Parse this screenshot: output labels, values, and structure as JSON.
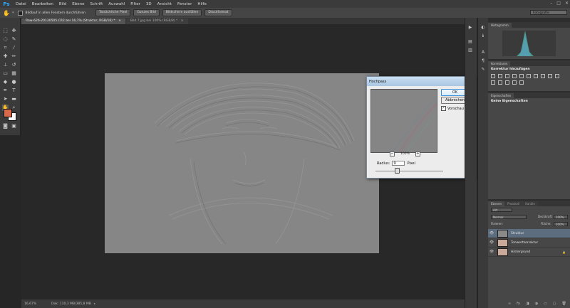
{
  "app": {
    "logo": "Ps"
  },
  "menu": [
    "Datei",
    "Bearbeiten",
    "Bild",
    "Ebene",
    "Schrift",
    "Auswahl",
    "Filter",
    "3D",
    "Ansicht",
    "Fenster",
    "Hilfe"
  ],
  "window_controls": [
    "–",
    "□",
    "✕"
  ],
  "options_bar": {
    "scroll_all_label": "Bildlauf in allen Fenstern durchführen",
    "buttons": [
      "Tatsächliche Pixel",
      "Ganzes Bild",
      "Bildschirm ausfüllen",
      "Druckformat"
    ],
    "workspace": "Fotografie"
  },
  "tabs": [
    {
      "label": "Raw-626-20130505.CR2 bei 16,7% (Struktur, RGB/16) *",
      "close": "×"
    },
    {
      "label": "Bild 7.jpg bei 100% (RGB/8) *",
      "close": "×"
    }
  ],
  "status": {
    "zoom": "16,67%",
    "doc": "Dok: 110,3 MB/385,8 MB"
  },
  "dialog": {
    "title": "Hochpass",
    "close": "✕",
    "ok": "OK",
    "cancel": "Abbrechen",
    "preview_label": "Vorschau",
    "preview_checked": "✓",
    "zoom_minus": "−",
    "zoom_plus": "+",
    "zoom_value": "100%",
    "radius_label": "Radius:",
    "radius_value": "9",
    "radius_unit": "Pixel"
  },
  "panels": {
    "histogram_tab": "Histogramm",
    "adjustments_tabs": [
      "Korrekturen"
    ],
    "adjustments_title": "Korrektur hinzufügen",
    "properties_tab": "Eigenschaften",
    "properties_text": "Keine Eigenschaften",
    "layers_tabs": [
      "Ebenen",
      "Protokoll",
      "Kanäle"
    ],
    "kind_filter": "Art",
    "blend_mode": "Normal",
    "opacity_label": "Deckkraft:",
    "opacity_value": "100%",
    "lock_label": "Fixieren:",
    "fill_label": "Fläche:",
    "fill_value": "100%",
    "eye_glyph": "👁",
    "lock_glyph": "🔒",
    "layers": [
      {
        "name": "Struktur"
      },
      {
        "name": "Tonwertkorrektur"
      },
      {
        "name": "Hintergrund"
      }
    ]
  },
  "colors": {
    "foreground": "#d8694a",
    "background": "#ffffff"
  }
}
